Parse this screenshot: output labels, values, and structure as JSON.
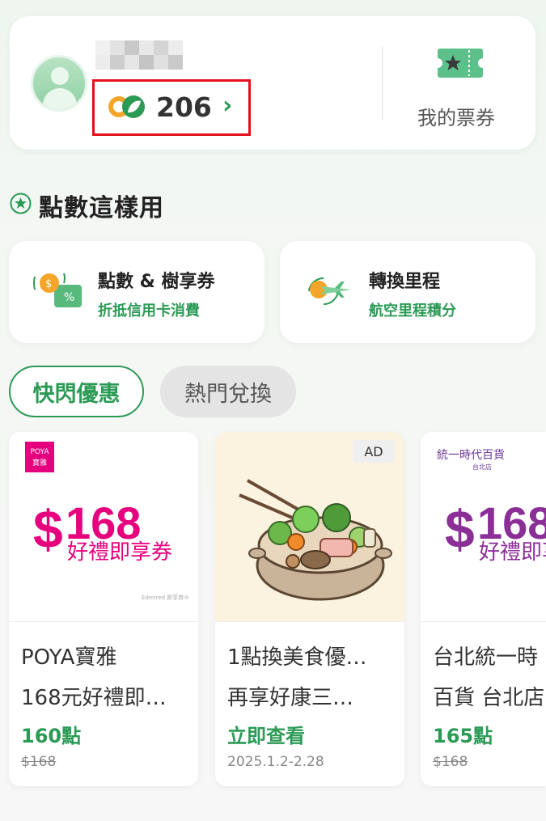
{
  "profile": {
    "points_value": "206",
    "ticket_label": "我的票券"
  },
  "section": {
    "title": "點數這樣用"
  },
  "usage_cards": [
    {
      "title": "點數 & 樹享券",
      "subtitle": "折抵信用卡消費"
    },
    {
      "title": "轉換里程",
      "subtitle": "航空里程積分"
    }
  ],
  "tabs": [
    {
      "label": "快閃優惠",
      "active": true
    },
    {
      "label": "熱門兌換",
      "active": false
    }
  ],
  "offers": [
    {
      "logo_text_1": "POYA",
      "logo_text_2": "寶雅",
      "price_symbol": "$",
      "price_number": "168",
      "price_caption": "好禮即享券",
      "edenred_text": "Edenred 即享券®",
      "line1": "POYA寶雅",
      "line2": "168元好禮即…",
      "points": "160點",
      "original_price": "$168",
      "price_color": "#e6007e"
    },
    {
      "ad_badge": "AD",
      "line1": "1點換美食優…",
      "line2": "再享好康三…",
      "points": "立即查看",
      "date": "2025.1.2-2.28"
    },
    {
      "store_logo": "統一時代百貨",
      "store_sub": "台北店",
      "price_symbol": "$",
      "price_number": "168",
      "price_caption": "好禮即享",
      "line1": "台北統一時",
      "line2": "百貨 台北店",
      "points": "165點",
      "original_price": "$168",
      "price_color": "#8b2f97"
    }
  ],
  "colors": {
    "brand_green": "#2b9a55",
    "highlight_red": "#e3101c"
  }
}
